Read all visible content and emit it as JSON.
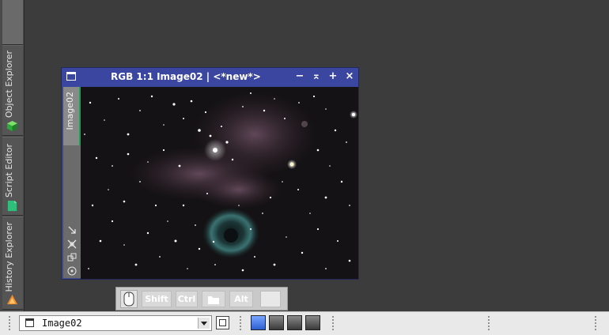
{
  "left_panel": {
    "tabs": [
      {
        "label": "Object Explorer",
        "icon": "green-cube-icon"
      },
      {
        "label": "Script Editor",
        "icon": "document-icon"
      },
      {
        "label": "History Explorer",
        "icon": "history-icon"
      }
    ]
  },
  "image_window": {
    "title": "RGB 1:1 Image02 | <*new*>",
    "view_tab": "Image02",
    "buttons": {
      "minimize": "−",
      "shade": "⌅",
      "maximize": "+",
      "close": "×"
    }
  },
  "modifier_keys": {
    "shift": "Shift",
    "ctrl": "Ctrl",
    "alt": "Alt"
  },
  "bottom_toolbar": {
    "view_selector": {
      "value": "Image02"
    },
    "colors": {
      "rgb_active": "#4a78d8",
      "channel_gray": "#5a5a5a"
    }
  }
}
